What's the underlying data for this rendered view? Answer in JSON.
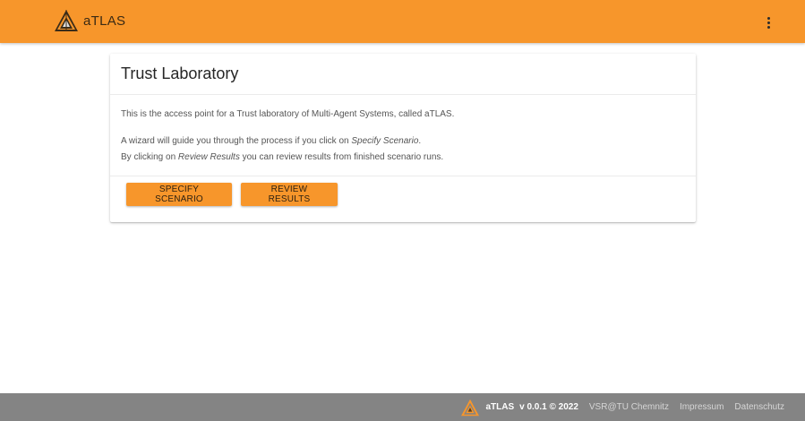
{
  "header": {
    "app_title": "aTLAS",
    "logo_icon": "atlas-triangle-logo",
    "menu_icon": "more-vertical-icon",
    "bar_color": "#f7962b"
  },
  "card": {
    "title": "Trust Laboratory",
    "intro": "This is the access point for a Trust laboratory of Multi-Agent Systems, called aTLAS.",
    "line2_prefix": "A wizard will guide you through the process if you click on ",
    "line2_emph": "Specify Scenario",
    "line2_suffix": ".",
    "line3_prefix": "By clicking on ",
    "line3_emph": "Review Results",
    "line3_suffix": " you can review results from finished scenario runs.",
    "buttons": {
      "specify": "SPECIFY SCENARIO",
      "review": "REVIEW RESULTS"
    }
  },
  "footer": {
    "app_name": "aTLAS",
    "version": "v 0.0.1 © 2022",
    "links": [
      "VSR@TU Chemnitz",
      "Impressum",
      "Datenschutz"
    ],
    "background": "#848484"
  }
}
